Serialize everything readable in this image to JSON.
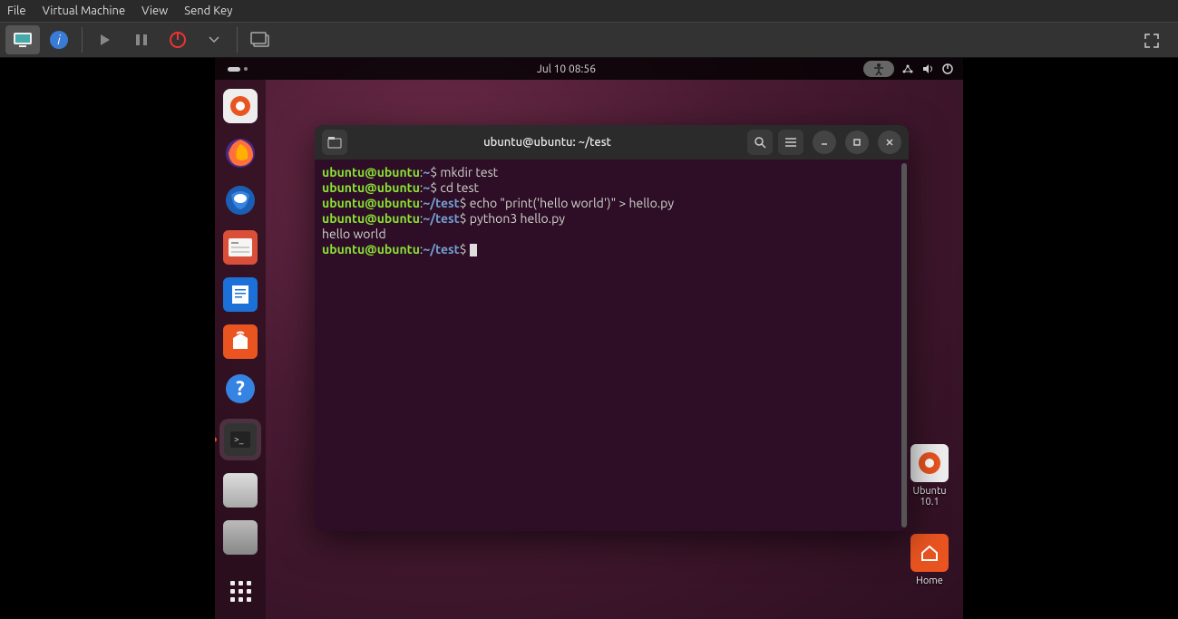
{
  "host": {
    "menu": {
      "file": "File",
      "vm": "Virtual Machine",
      "view": "View",
      "sendkey": "Send Key"
    }
  },
  "guest": {
    "topbar": {
      "datetime": "Jul 10  08:56"
    },
    "dock": {
      "items": [
        {
          "name": "installer"
        },
        {
          "name": "firefox"
        },
        {
          "name": "thunderbird"
        },
        {
          "name": "files"
        },
        {
          "name": "writer"
        },
        {
          "name": "software"
        },
        {
          "name": "help"
        },
        {
          "name": "terminal"
        },
        {
          "name": "disk1"
        },
        {
          "name": "disk2"
        }
      ]
    },
    "desktop": {
      "ubuntu_label": "Ubuntu 10.1",
      "home_label": "Home"
    },
    "terminal": {
      "title": "ubuntu@ubuntu: ~/test",
      "lines": [
        {
          "user": "ubuntu@ubuntu",
          "path": "~",
          "cmd": "mkdir test"
        },
        {
          "user": "ubuntu@ubuntu",
          "path": "~",
          "cmd": "cd test"
        },
        {
          "user": "ubuntu@ubuntu",
          "path": "~/test",
          "cmd": "echo \"print('hello world')\" > hello.py"
        },
        {
          "user": "ubuntu@ubuntu",
          "path": "~/test",
          "cmd": "python3 hello.py"
        }
      ],
      "output": "hello world",
      "prompt": {
        "user": "ubuntu@ubuntu",
        "path": "~/test"
      }
    }
  }
}
